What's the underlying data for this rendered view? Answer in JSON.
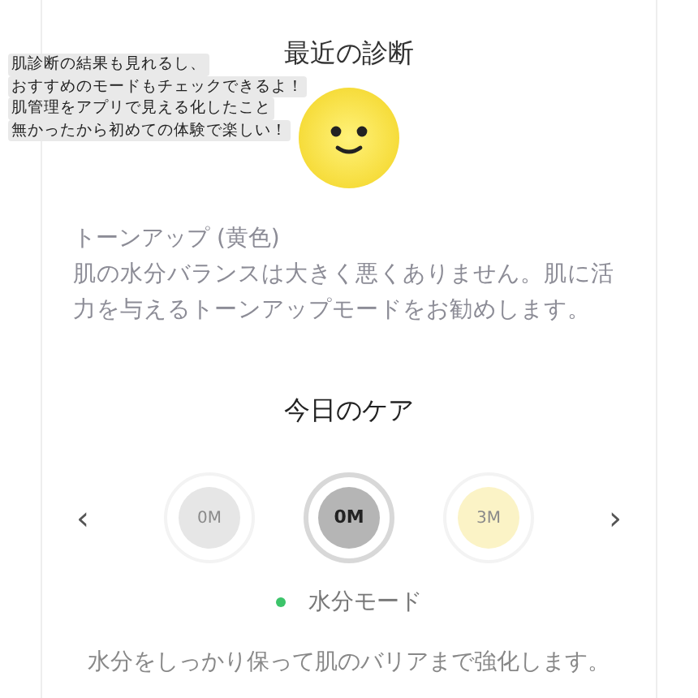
{
  "caption": [
    "肌診断の結果も見れるし、",
    "おすすめのモードもチェックできるよ！",
    "肌管理をアプリで見える化したこと",
    "無かったから初めての体験で楽しい！"
  ],
  "diagnosis": {
    "title": "最近の診断",
    "result_title": "トーンアップ (黄色)",
    "result_text": "肌の水分バランスは大きく悪くありません。肌に活力を与えるトーンアップモードをお勧めします。"
  },
  "care": {
    "title": "今日のケア",
    "prev": "‹",
    "next": "›",
    "modes": [
      {
        "label": "0M",
        "color": "#e6e6e6",
        "selected": false
      },
      {
        "label": "0M",
        "color": "#b5b5b5",
        "selected": true
      },
      {
        "label": "3M",
        "color": "#fbf3c6",
        "selected": false
      }
    ],
    "mode_name": "水分モード",
    "description": "水分をしっかり保って肌のバリアまで強化します。"
  }
}
